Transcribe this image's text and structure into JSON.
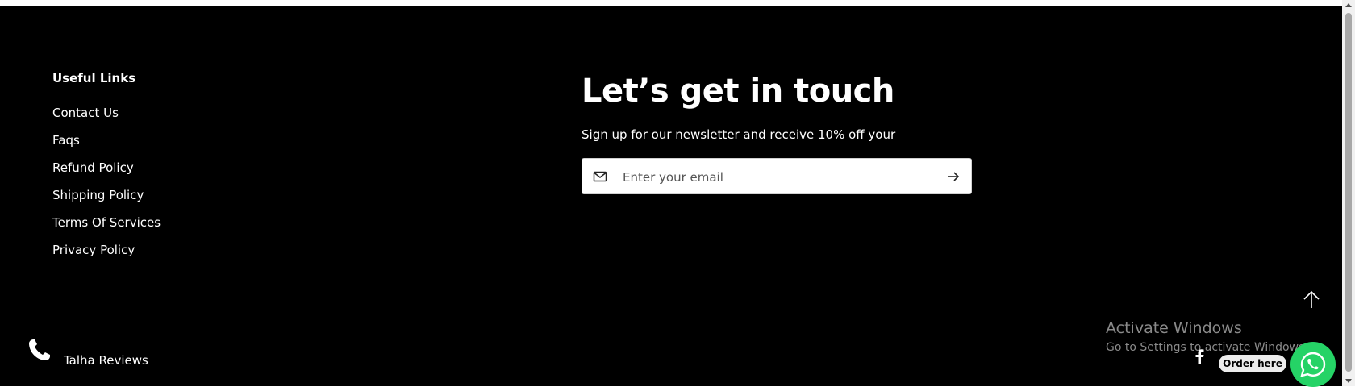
{
  "useful_links": {
    "title": "Useful Links",
    "items": [
      "Contact Us",
      "Faqs",
      "Refund Policy",
      "Shipping Policy",
      "Terms Of Services",
      "Privacy Policy"
    ]
  },
  "newsletter": {
    "heading": "Let’s get in touch",
    "text": "Sign up for our newsletter and receive 10% off your",
    "email_placeholder": "Enter your email"
  },
  "contact": {
    "label": "Talha Reviews",
    "icon": "phone-icon"
  },
  "watermark": {
    "title": "Activate Windows",
    "subtitle": "Go to Settings to activate Windows."
  },
  "order": {
    "label": "Order here"
  },
  "colors": {
    "background": "#000000",
    "text": "#ffffff",
    "whatsapp": "#25d366"
  }
}
